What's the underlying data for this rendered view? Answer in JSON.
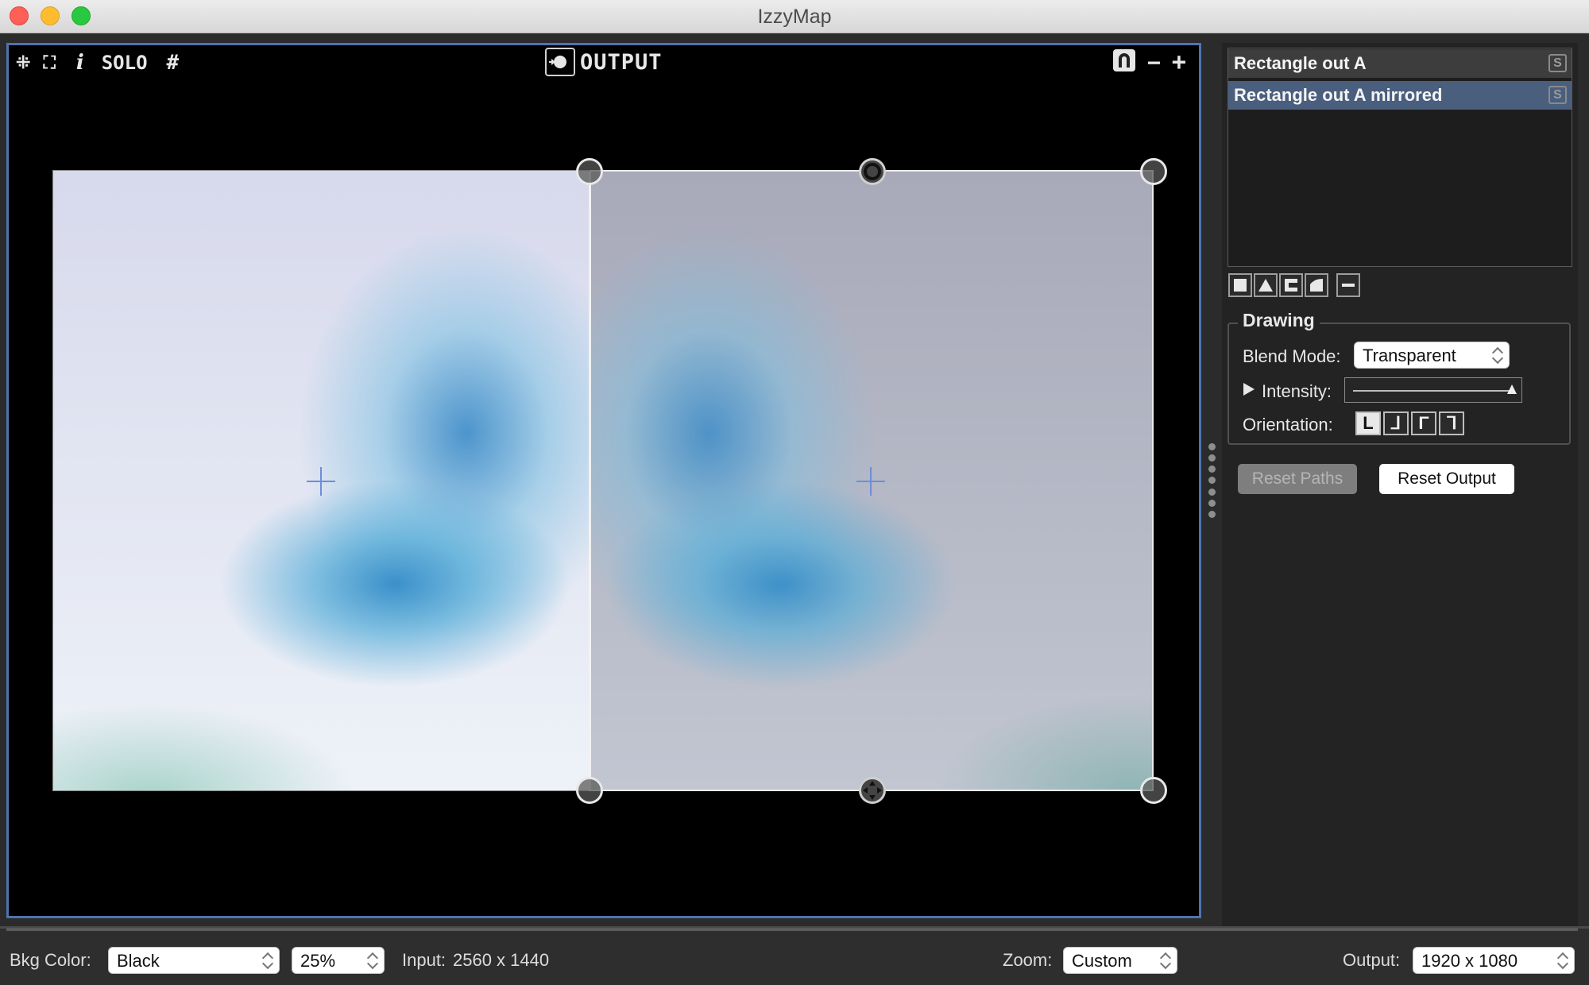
{
  "window": {
    "title": "IzzyMap"
  },
  "toolbar": {
    "collapse_glyph": "⁜",
    "fullscreen_glyph": "⛶",
    "info_glyph": "i",
    "solo_label": "SOLO",
    "grid_glyph": "#",
    "output_label": "OUTPUT",
    "zoom_out_glyph": "−",
    "zoom_in_glyph": "+"
  },
  "shapes": {
    "items": [
      {
        "label": "Rectangle out A",
        "solo": "S",
        "selected": false
      },
      {
        "label": "Rectangle out A mirrored",
        "solo": "S",
        "selected": true
      }
    ]
  },
  "drawing": {
    "section_title": "Drawing",
    "blend_mode_label": "Blend Mode:",
    "blend_mode_value": "Transparent",
    "intensity_label": "Intensity:",
    "intensity_fraction": 1.0,
    "orientation_label": "Orientation:",
    "orientation_options": [
      "L",
      "⅃",
      "Γ",
      "ᒣ"
    ]
  },
  "buttons": {
    "reset_paths": "Reset Paths",
    "reset_output": "Reset Output"
  },
  "bottom": {
    "bkg_color_label": "Bkg Color:",
    "bkg_color_value": "Black",
    "percent_value": "25%",
    "input_label": "Input:",
    "input_value": "2560 x 1440",
    "zoom_label": "Zoom:",
    "zoom_value": "Custom",
    "output_label": "Output:",
    "output_value": "1920 x 1080"
  },
  "colors": {
    "accent_blue": "#4f73b0",
    "selected_row": "#4a5e7e",
    "close": "#fe5f57",
    "minimize": "#febc2e",
    "maximize": "#28c840"
  }
}
